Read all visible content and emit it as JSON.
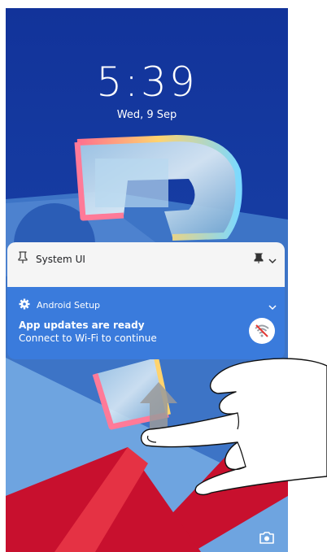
{
  "lock_screen": {
    "time": "5:39",
    "date": "Wed, 9 Sep"
  },
  "notifications": {
    "silent": {
      "app_name": "System UI",
      "icon": "pin-icon",
      "action_icon": "pin-icon"
    },
    "setup": {
      "app_name": "Android Setup",
      "icon": "gear-icon",
      "title": "App updates are ready",
      "text": "Connect to Wi-Fi to continue",
      "badge_icon": "wifi-off-icon"
    }
  },
  "bottom": {
    "camera_icon": "camera-icon"
  },
  "gesture": {
    "icon": "hand-swipe-up-icon",
    "direction": "up"
  },
  "colors": {
    "wallpaper_blue": "#14389b",
    "wallpaper_red": "#c8102e",
    "notification_accent": "#3a7bdc",
    "notification_bg": "#f5f5f5",
    "badge_slash": "#e53935"
  }
}
